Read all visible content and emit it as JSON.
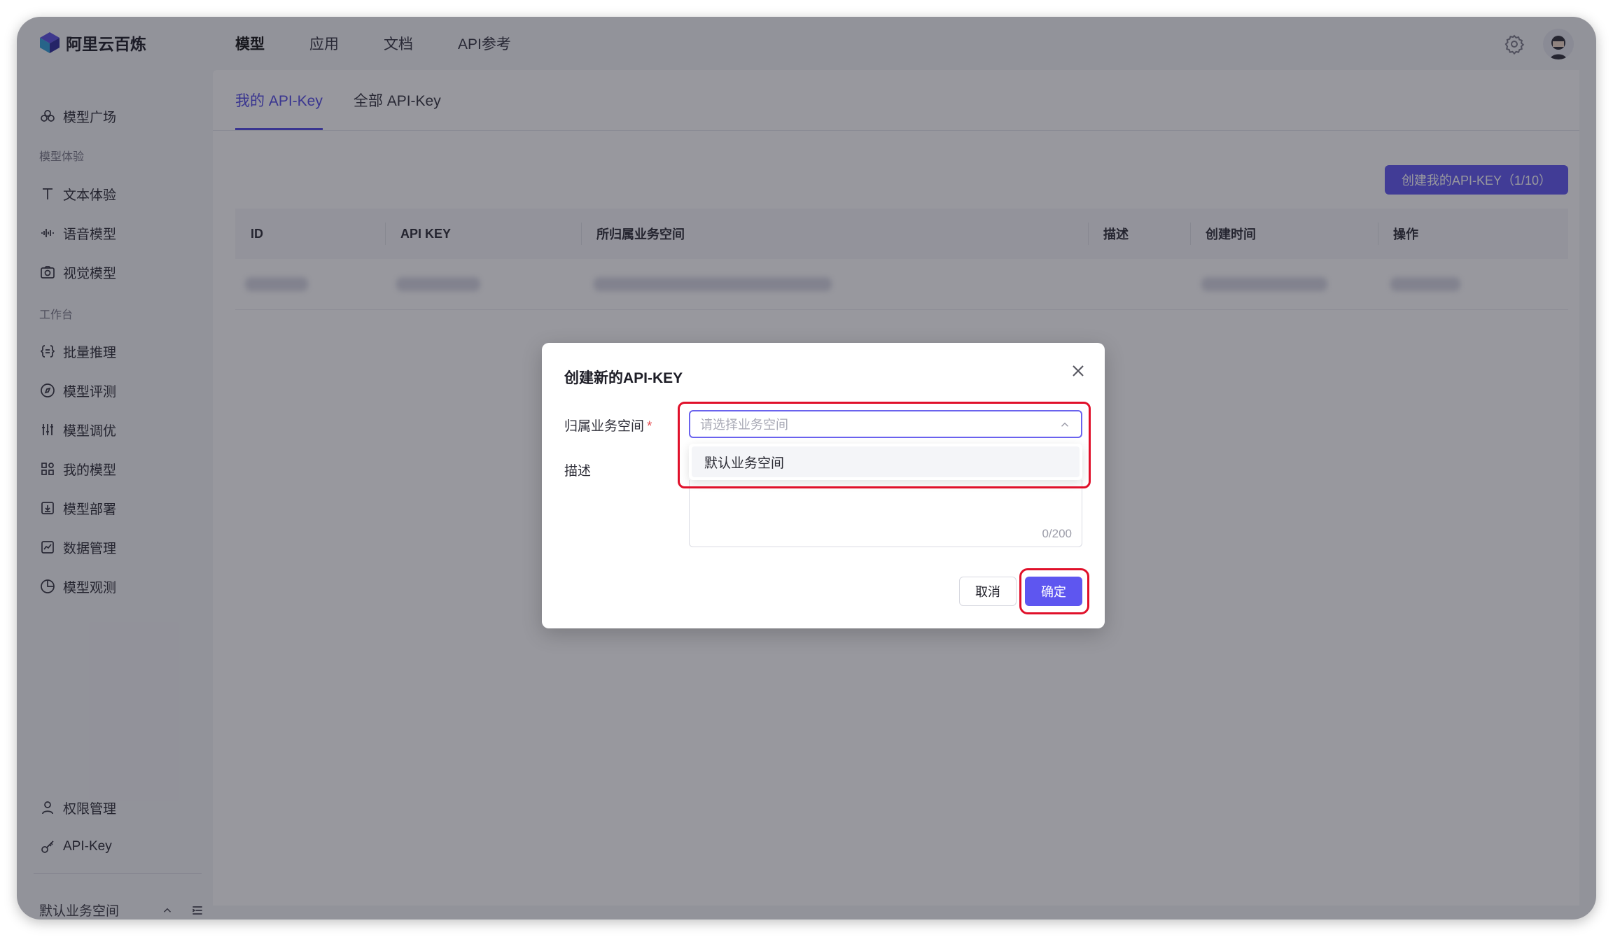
{
  "app": {
    "name": "阿里云百炼"
  },
  "topnav": {
    "items": [
      "模型",
      "应用",
      "文档",
      "API参考"
    ],
    "active_index": 0
  },
  "sidebar": {
    "model_square": "模型广场",
    "group_experience": "模型体验",
    "text_experience": "文本体验",
    "voice_model": "语音模型",
    "vision_model": "视觉模型",
    "group_workbench": "工作台",
    "batch_inference": "批量推理",
    "model_evaluation": "模型评测",
    "model_tuning": "模型调优",
    "my_models": "我的模型",
    "model_deploy": "模型部署",
    "data_management": "数据管理",
    "model_observe": "模型观测",
    "permission_management": "权限管理",
    "api_key": "API-Key",
    "workspace": "默认业务空间"
  },
  "tabs": {
    "my_api_key": "我的 API-Key",
    "all_api_key": "全部 API-Key"
  },
  "create_button": "创建我的API-KEY（1/10）",
  "table": {
    "headers": {
      "id": "ID",
      "api_key": "API KEY",
      "workspace": "所归属业务空间",
      "description": "描述",
      "created": "创建时间",
      "actions": "操作"
    }
  },
  "modal": {
    "title": "创建新的API-KEY",
    "workspace_label": "归属业务空间",
    "required_mark": "*",
    "workspace_placeholder": "请选择业务空间",
    "workspace_option": "默认业务空间",
    "description_label": "描述",
    "char_counter": "0/200",
    "cancel": "取消",
    "confirm": "确定"
  },
  "colors": {
    "primary": "#5E56F0",
    "highlight": "#E0102A",
    "overlay": "rgba(30,30,44,0.46)"
  }
}
